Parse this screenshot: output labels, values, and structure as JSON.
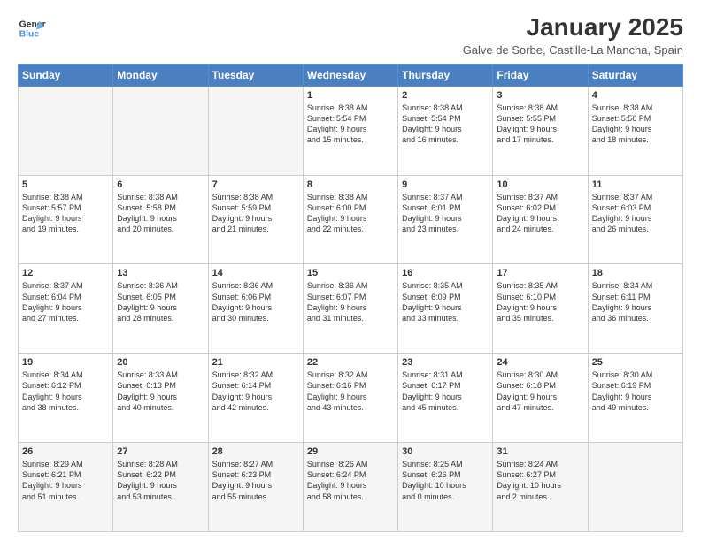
{
  "logo": {
    "line1": "General",
    "line2": "Blue"
  },
  "title": "January 2025",
  "subtitle": "Galve de Sorbe, Castille-La Mancha, Spain",
  "days_of_week": [
    "Sunday",
    "Monday",
    "Tuesday",
    "Wednesday",
    "Thursday",
    "Friday",
    "Saturday"
  ],
  "weeks": [
    [
      {
        "day": "",
        "info": ""
      },
      {
        "day": "",
        "info": ""
      },
      {
        "day": "",
        "info": ""
      },
      {
        "day": "1",
        "info": "Sunrise: 8:38 AM\nSunset: 5:54 PM\nDaylight: 9 hours\nand 15 minutes."
      },
      {
        "day": "2",
        "info": "Sunrise: 8:38 AM\nSunset: 5:54 PM\nDaylight: 9 hours\nand 16 minutes."
      },
      {
        "day": "3",
        "info": "Sunrise: 8:38 AM\nSunset: 5:55 PM\nDaylight: 9 hours\nand 17 minutes."
      },
      {
        "day": "4",
        "info": "Sunrise: 8:38 AM\nSunset: 5:56 PM\nDaylight: 9 hours\nand 18 minutes."
      }
    ],
    [
      {
        "day": "5",
        "info": "Sunrise: 8:38 AM\nSunset: 5:57 PM\nDaylight: 9 hours\nand 19 minutes."
      },
      {
        "day": "6",
        "info": "Sunrise: 8:38 AM\nSunset: 5:58 PM\nDaylight: 9 hours\nand 20 minutes."
      },
      {
        "day": "7",
        "info": "Sunrise: 8:38 AM\nSunset: 5:59 PM\nDaylight: 9 hours\nand 21 minutes."
      },
      {
        "day": "8",
        "info": "Sunrise: 8:38 AM\nSunset: 6:00 PM\nDaylight: 9 hours\nand 22 minutes."
      },
      {
        "day": "9",
        "info": "Sunrise: 8:37 AM\nSunset: 6:01 PM\nDaylight: 9 hours\nand 23 minutes."
      },
      {
        "day": "10",
        "info": "Sunrise: 8:37 AM\nSunset: 6:02 PM\nDaylight: 9 hours\nand 24 minutes."
      },
      {
        "day": "11",
        "info": "Sunrise: 8:37 AM\nSunset: 6:03 PM\nDaylight: 9 hours\nand 26 minutes."
      }
    ],
    [
      {
        "day": "12",
        "info": "Sunrise: 8:37 AM\nSunset: 6:04 PM\nDaylight: 9 hours\nand 27 minutes."
      },
      {
        "day": "13",
        "info": "Sunrise: 8:36 AM\nSunset: 6:05 PM\nDaylight: 9 hours\nand 28 minutes."
      },
      {
        "day": "14",
        "info": "Sunrise: 8:36 AM\nSunset: 6:06 PM\nDaylight: 9 hours\nand 30 minutes."
      },
      {
        "day": "15",
        "info": "Sunrise: 8:36 AM\nSunset: 6:07 PM\nDaylight: 9 hours\nand 31 minutes."
      },
      {
        "day": "16",
        "info": "Sunrise: 8:35 AM\nSunset: 6:09 PM\nDaylight: 9 hours\nand 33 minutes."
      },
      {
        "day": "17",
        "info": "Sunrise: 8:35 AM\nSunset: 6:10 PM\nDaylight: 9 hours\nand 35 minutes."
      },
      {
        "day": "18",
        "info": "Sunrise: 8:34 AM\nSunset: 6:11 PM\nDaylight: 9 hours\nand 36 minutes."
      }
    ],
    [
      {
        "day": "19",
        "info": "Sunrise: 8:34 AM\nSunset: 6:12 PM\nDaylight: 9 hours\nand 38 minutes."
      },
      {
        "day": "20",
        "info": "Sunrise: 8:33 AM\nSunset: 6:13 PM\nDaylight: 9 hours\nand 40 minutes."
      },
      {
        "day": "21",
        "info": "Sunrise: 8:32 AM\nSunset: 6:14 PM\nDaylight: 9 hours\nand 42 minutes."
      },
      {
        "day": "22",
        "info": "Sunrise: 8:32 AM\nSunset: 6:16 PM\nDaylight: 9 hours\nand 43 minutes."
      },
      {
        "day": "23",
        "info": "Sunrise: 8:31 AM\nSunset: 6:17 PM\nDaylight: 9 hours\nand 45 minutes."
      },
      {
        "day": "24",
        "info": "Sunrise: 8:30 AM\nSunset: 6:18 PM\nDaylight: 9 hours\nand 47 minutes."
      },
      {
        "day": "25",
        "info": "Sunrise: 8:30 AM\nSunset: 6:19 PM\nDaylight: 9 hours\nand 49 minutes."
      }
    ],
    [
      {
        "day": "26",
        "info": "Sunrise: 8:29 AM\nSunset: 6:21 PM\nDaylight: 9 hours\nand 51 minutes."
      },
      {
        "day": "27",
        "info": "Sunrise: 8:28 AM\nSunset: 6:22 PM\nDaylight: 9 hours\nand 53 minutes."
      },
      {
        "day": "28",
        "info": "Sunrise: 8:27 AM\nSunset: 6:23 PM\nDaylight: 9 hours\nand 55 minutes."
      },
      {
        "day": "29",
        "info": "Sunrise: 8:26 AM\nSunset: 6:24 PM\nDaylight: 9 hours\nand 58 minutes."
      },
      {
        "day": "30",
        "info": "Sunrise: 8:25 AM\nSunset: 6:26 PM\nDaylight: 10 hours\nand 0 minutes."
      },
      {
        "day": "31",
        "info": "Sunrise: 8:24 AM\nSunset: 6:27 PM\nDaylight: 10 hours\nand 2 minutes."
      },
      {
        "day": "",
        "info": ""
      }
    ]
  ]
}
